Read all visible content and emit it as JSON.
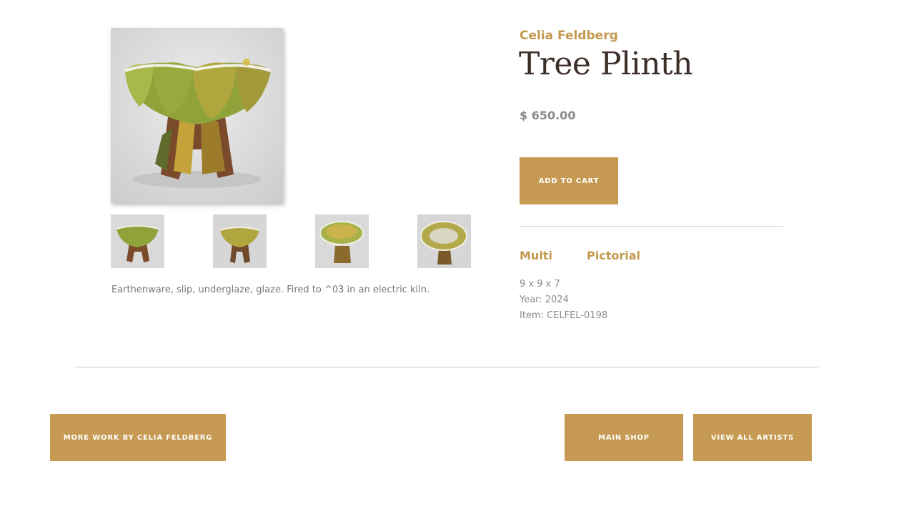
{
  "product": {
    "artist": "Celia Feldberg",
    "title": "Tree Plinth",
    "price": "$ 650.00",
    "add_to_cart_label": "ADD TO CART",
    "description": "Earthenware, slip, underglaze, glaze. Fired to ^03 in an electric kiln.",
    "tags": [
      "Multi",
      "Pictorial"
    ],
    "dimensions": "9 x 9 x 7",
    "year": "Year: 2024",
    "item": "Item: CELFEL-0198"
  },
  "gallery": {
    "main_image": "tree-plinth-photo",
    "thumbnails": [
      "thumb-1",
      "thumb-2",
      "thumb-3",
      "thumb-4"
    ]
  },
  "footer_nav": {
    "more_work_label": "MORE WORK BY CELIA FELDBERG",
    "main_shop_label": "MAIN SHOP",
    "view_all_artists_label": "VIEW ALL ARTISTS"
  },
  "colors": {
    "accent": "#c69a52",
    "title": "#3c2f2a",
    "muted_text": "#8a8a8a"
  }
}
